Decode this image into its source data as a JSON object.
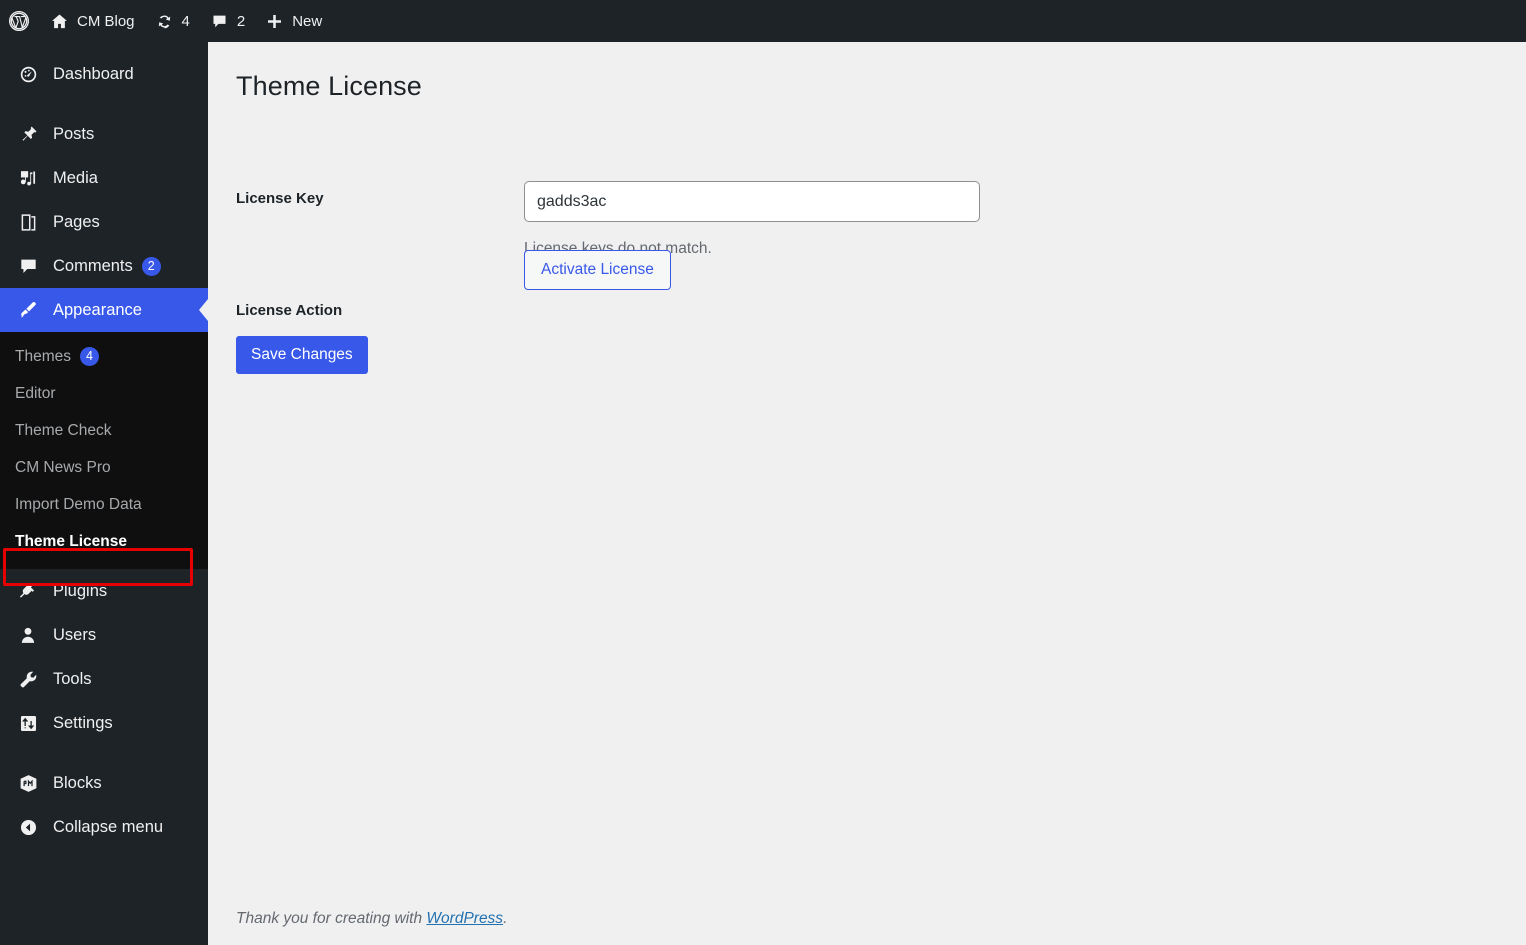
{
  "adminbar": {
    "items": [
      {
        "icon": "wordpress-logo-icon",
        "label": "",
        "count": ""
      },
      {
        "icon": "home-icon",
        "label": "CM Blog",
        "count": ""
      },
      {
        "icon": "updates-icon",
        "label": "",
        "count": "4"
      },
      {
        "icon": "comment-bubble-icon",
        "label": "",
        "count": "2"
      },
      {
        "icon": "plus-icon",
        "label": "New",
        "count": ""
      }
    ]
  },
  "sidebar": {
    "items": [
      {
        "label": "Dashboard",
        "icon": "dashboard-icon",
        "badge": "",
        "current": false
      },
      {
        "label": "Posts",
        "icon": "pin-icon",
        "badge": "",
        "current": false
      },
      {
        "label": "Media",
        "icon": "media-icon",
        "badge": "",
        "current": false
      },
      {
        "label": "Pages",
        "icon": "pages-icon",
        "badge": "",
        "current": false
      },
      {
        "label": "Comments",
        "icon": "comment-bubble-icon",
        "badge": "2",
        "current": false
      },
      {
        "label": "Appearance",
        "icon": "brush-icon",
        "badge": "",
        "current": true
      },
      {
        "label": "Plugins",
        "icon": "plug-icon",
        "badge": "",
        "current": false
      },
      {
        "label": "Users",
        "icon": "user-icon",
        "badge": "",
        "current": false
      },
      {
        "label": "Tools",
        "icon": "wrench-icon",
        "badge": "",
        "current": false
      },
      {
        "label": "Settings",
        "icon": "sliders-icon",
        "badge": "",
        "current": false
      },
      {
        "label": "Blocks",
        "icon": "blocks-cube-icon",
        "badge": "",
        "current": false
      },
      {
        "label": "Collapse menu",
        "icon": "collapse-arrow-icon",
        "badge": "",
        "current": false
      }
    ],
    "submenu": [
      {
        "label": "Themes",
        "badge": "4",
        "current": false
      },
      {
        "label": "Editor",
        "badge": "",
        "current": false
      },
      {
        "label": "Theme Check",
        "badge": "",
        "current": false
      },
      {
        "label": "CM News Pro",
        "badge": "",
        "current": false
      },
      {
        "label": "Import Demo Data",
        "badge": "",
        "current": false
      },
      {
        "label": "Theme License",
        "badge": "",
        "current": true
      }
    ]
  },
  "main": {
    "title": "Theme License",
    "rows": [
      {
        "label": "License Key"
      },
      {
        "label": "License Action"
      }
    ],
    "license_key_value": "gadds3ac",
    "license_key_placeholder": "",
    "license_error": "License keys do not match.",
    "activate_label": "Activate License",
    "save_label": "Save Changes"
  },
  "footer": {
    "prefix": "Thank you for creating with ",
    "link": "WordPress",
    "suffix": "."
  },
  "colors": {
    "sidebar_bg": "#1d2327",
    "submenu_bg": "#0f0f0f",
    "accent_blue": "#3858e9",
    "content_bg": "#f0f0f1",
    "highlight_red": "#e60000",
    "muted_text": "#646970",
    "link_blue": "#2271b1"
  }
}
